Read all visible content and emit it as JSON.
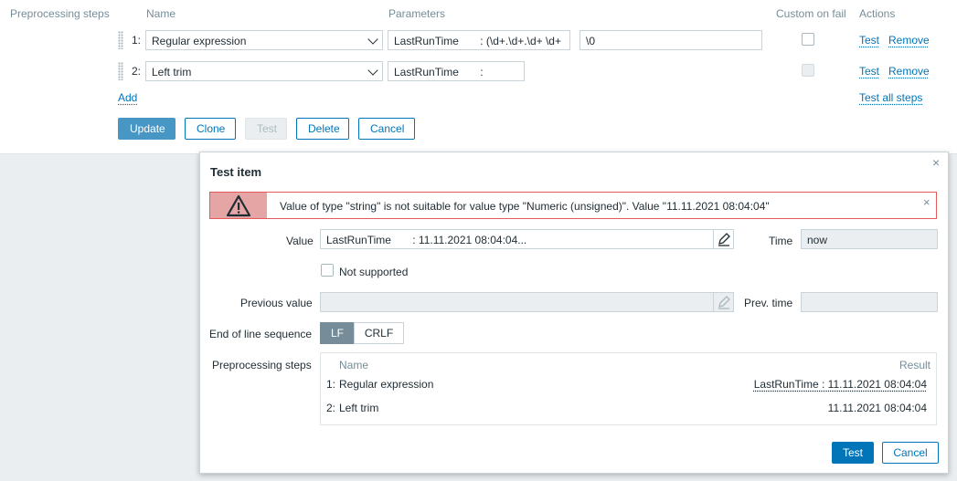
{
  "form": {
    "section_label": "Preprocessing steps",
    "headers": {
      "name": "Name",
      "parameters": "Parameters",
      "custom_on_fail": "Custom on fail",
      "actions": "Actions"
    },
    "steps": [
      {
        "num": "1:",
        "name": "Regular expression",
        "param1": "LastRunTime       : (\\d+.\\d+.\\d+ \\d+",
        "param2": "\\0",
        "test": "Test",
        "remove": "Remove"
      },
      {
        "num": "2:",
        "name": "Left trim",
        "param1": "LastRunTime       :",
        "test": "Test",
        "remove": "Remove"
      }
    ],
    "add_link": "Add",
    "test_all_link": "Test all steps",
    "buttons": {
      "update": "Update",
      "clone": "Clone",
      "test": "Test",
      "delete": "Delete",
      "cancel": "Cancel"
    }
  },
  "dialog": {
    "title": "Test item",
    "close": "×",
    "error": {
      "message": "Value of type \"string\" is not suitable for value type \"Numeric (unsigned)\". Value \"11.11.2021 08:04:04\"",
      "close": "×"
    },
    "value_label": "Value",
    "value": "LastRunTime       : 11.11.2021 08:04:04...",
    "time_label": "Time",
    "time_value": "now",
    "not_supported_label": "Not supported",
    "previous_value_label": "Previous value",
    "prev_time_label": "Prev. time",
    "eol_label": "End of line sequence",
    "eol_options": [
      "LF",
      "CRLF"
    ],
    "eol_selected": "LF",
    "pp_label": "Preprocessing steps",
    "pp_headers": {
      "name": "Name",
      "result": "Result"
    },
    "pp_steps": [
      {
        "num": "1:",
        "name": "Regular expression",
        "result": "LastRunTime : 11.11.2021 08:04:04"
      },
      {
        "num": "2:",
        "name": "Left trim",
        "result": "11.11.2021 08:04:04"
      }
    ],
    "buttons": {
      "test": "Test",
      "cancel": "Cancel"
    }
  },
  "icons": {
    "warning": "warning-triangle-icon",
    "edit": "pencil-icon",
    "drag": "drag-handle-icon"
  },
  "colors": {
    "accent": "#0275b8",
    "error": "#e45959",
    "error_bg": "#e6a5a5",
    "eol_selected_bg": "#768d99"
  }
}
